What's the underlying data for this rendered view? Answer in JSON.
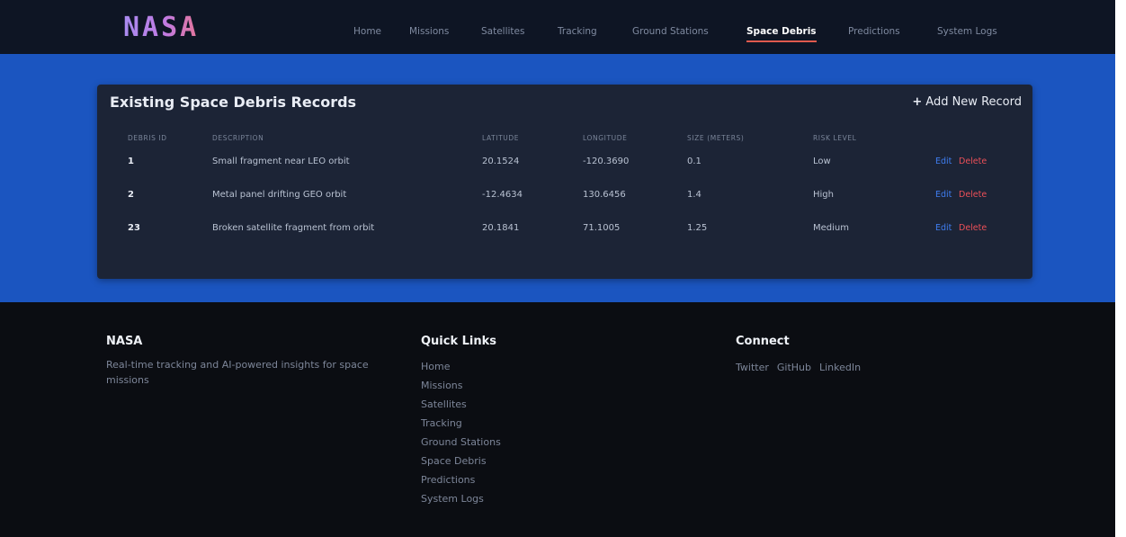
{
  "header": {
    "logo": "NASA",
    "nav": [
      "Home",
      "Missions",
      "Satellites",
      "Tracking",
      "Ground Stations",
      "Space Debris",
      "Predictions",
      "System Logs"
    ],
    "active_nav": "Space Debris"
  },
  "debris": {
    "title": "Existing Space Debris Records",
    "add_label": "Add New Record",
    "columns": [
      "Debris ID",
      "Description",
      "Latitude",
      "Longitude",
      "Size (meters)",
      "Risk Level"
    ],
    "rows": [
      {
        "id": "1",
        "description": "Small fragment near LEO orbit",
        "latitude": "20.1524",
        "longitude": "-120.3690",
        "size": "0.1",
        "risk": "Low"
      },
      {
        "id": "2",
        "description": "Metal panel drifting GEO orbit",
        "latitude": "-12.4634",
        "longitude": "130.6456",
        "size": "1.4",
        "risk": "High"
      },
      {
        "id": "23",
        "description": "Broken satellite fragment from orbit",
        "latitude": "20.1841",
        "longitude": "71.1005",
        "size": "1.25",
        "risk": "Medium"
      }
    ],
    "edit_label": "Edit",
    "delete_label": "Delete"
  },
  "footer": {
    "brand": {
      "heading": "NASA",
      "text": "Real-time tracking and AI-powered insights for space missions"
    },
    "quick_links": {
      "heading": "Quick Links",
      "links": [
        "Home",
        "Missions",
        "Satellites",
        "Tracking",
        "Ground Stations",
        "Space Debris",
        "Predictions",
        "System Logs"
      ]
    },
    "connect": {
      "heading": "Connect",
      "links": [
        "Twitter",
        "GitHub",
        "LinkedIn"
      ]
    }
  },
  "colors": {
    "brand_gradient_start": "#a98bf0",
    "brand_gradient_end": "#e4759a",
    "band_blue": "#1b55c0",
    "edit_blue": "#3f7df0",
    "delete_red": "#ea4f58",
    "active_underline": "#e05a4e"
  }
}
